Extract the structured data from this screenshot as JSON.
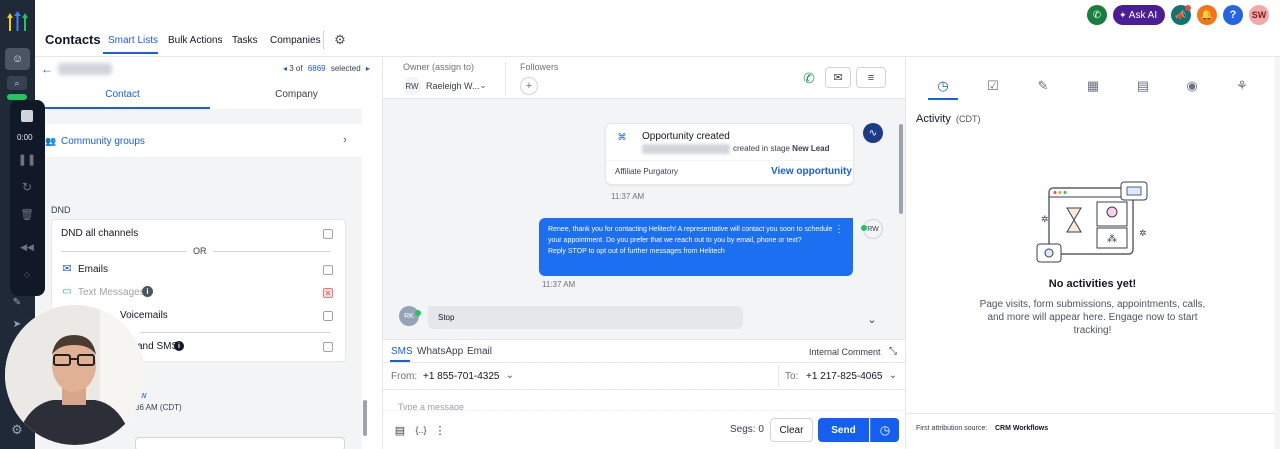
{
  "colors": {
    "accent": "#155eef",
    "sidebar": "#1f2937",
    "bubble": "#1d6ff2",
    "danger": "#ef4444"
  },
  "topnav": {
    "title": "Contacts",
    "tabs": [
      "Smart Lists",
      "Bulk Actions",
      "Tasks",
      "Companies"
    ],
    "settings_icon": "gear-icon"
  },
  "header_right": {
    "ask_ai": "Ask AI",
    "avatar": "SW",
    "help": "?"
  },
  "record_nav": {
    "position": "3 of",
    "total": "6869",
    "selected": "selected"
  },
  "left_tabs": [
    "Contact",
    "Company"
  ],
  "left": {
    "community": "Community groups",
    "dnd_header": "DND",
    "dnd_all": "DND all channels",
    "or": "OR",
    "emails": "Emails",
    "text_messages": "Text Messages",
    "voicemails": "Voicemails",
    "calls_sms": "and SMS",
    "footer_name": "w",
    "footer_time": "36 AM (CDT)"
  },
  "recorder": {
    "time": "0:00"
  },
  "owner": {
    "label": "Owner (assign to)",
    "initials": "RW",
    "name": "Raeleigh W..."
  },
  "followers": {
    "label": "Followers",
    "add": "+"
  },
  "conversation": {
    "opportunity_title": "Opportunity created",
    "opportunity_stage_prefix": "created in stage",
    "opportunity_stage": "New Lead",
    "pipeline": "Affiliate Purgatory",
    "view_link": "View opportunity",
    "time1": "11:37 AM",
    "outbound_text": "Renee, thank you for contacting Helitech! A representative will contact you soon to schedule your appointment. Do you prefer that we reach out to you by email, phone or text?\nReply STOP to opt out of further messages from Helitech",
    "outbound_initials": "RW",
    "time2": "11:37 AM",
    "inbound_text": "Stop",
    "inbound_initials": "RK"
  },
  "composer": {
    "tabs": [
      "SMS",
      "WhatsApp",
      "Email"
    ],
    "internal_comment": "Internal Comment",
    "from_label": "From:",
    "from_number": "+1 855-701-4325",
    "to_label": "To:",
    "to_number": "+1 217-825-4065",
    "placeholder": "Type a message",
    "segs": "Segs: 0",
    "clear": "Clear",
    "send": "Send"
  },
  "activity": {
    "title": "Activity",
    "tz": "(CDT)",
    "empty_title": "No activities yet!",
    "empty_desc": "Page visits, form submissions, appointments, calls, and more will appear here. Engage now to start tracking!",
    "attribution_label": "First attribution source:",
    "attribution_value": "CRM Workflows"
  }
}
